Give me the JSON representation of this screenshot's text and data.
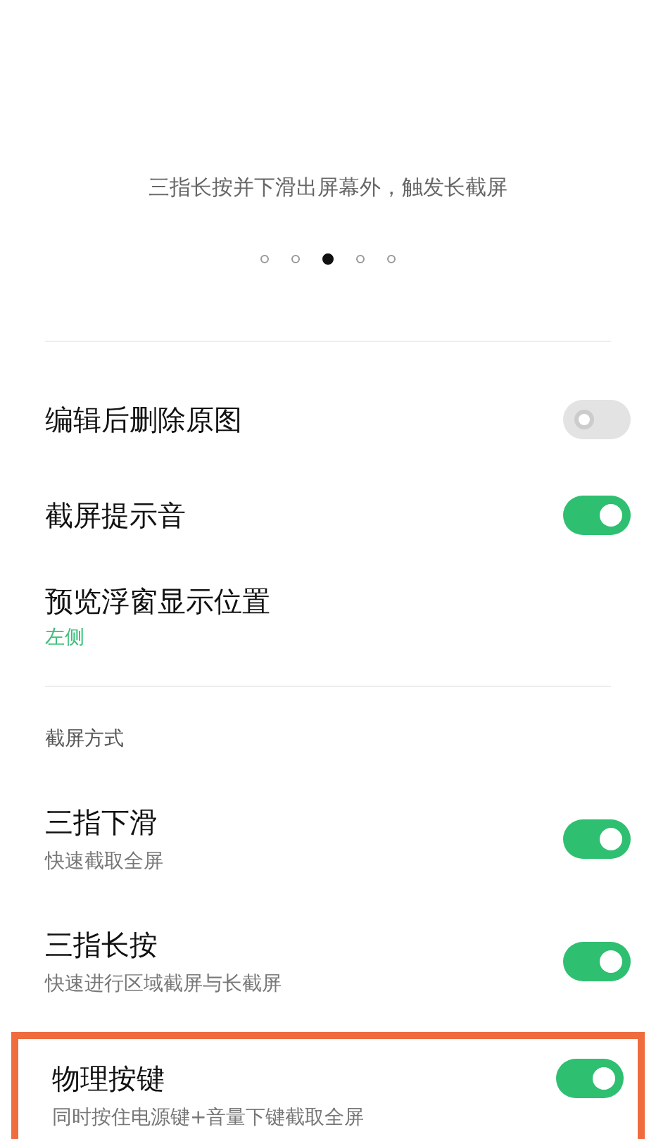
{
  "description": "三指长按并下滑出屏幕外，触发长截屏",
  "pager": [
    {
      "selected": false
    },
    {
      "selected": false
    },
    {
      "selected": true
    },
    {
      "selected": false
    },
    {
      "selected": false
    }
  ],
  "settings": [
    {
      "kind": "toggle",
      "title": "编辑后删除原图",
      "on": false
    },
    {
      "kind": "toggle",
      "title": "截屏提示音",
      "on": true
    },
    {
      "kind": "value",
      "title": "预览浮窗显示位置",
      "value": "左侧"
    }
  ],
  "section": {
    "header": "截屏方式",
    "items": [
      {
        "kind": "toggle",
        "title": "三指下滑",
        "subtitle": "快速截取全屏",
        "on": true,
        "highlighted": false
      },
      {
        "kind": "toggle",
        "title": "三指长按",
        "subtitle": "快速进行区域截屏与长截屏",
        "on": true,
        "highlighted": false
      },
      {
        "kind": "toggle",
        "title": "物理按键",
        "subtitle": "同时按住电源键+音量下键截取全屏",
        "on": true,
        "highlighted": true
      }
    ]
  }
}
